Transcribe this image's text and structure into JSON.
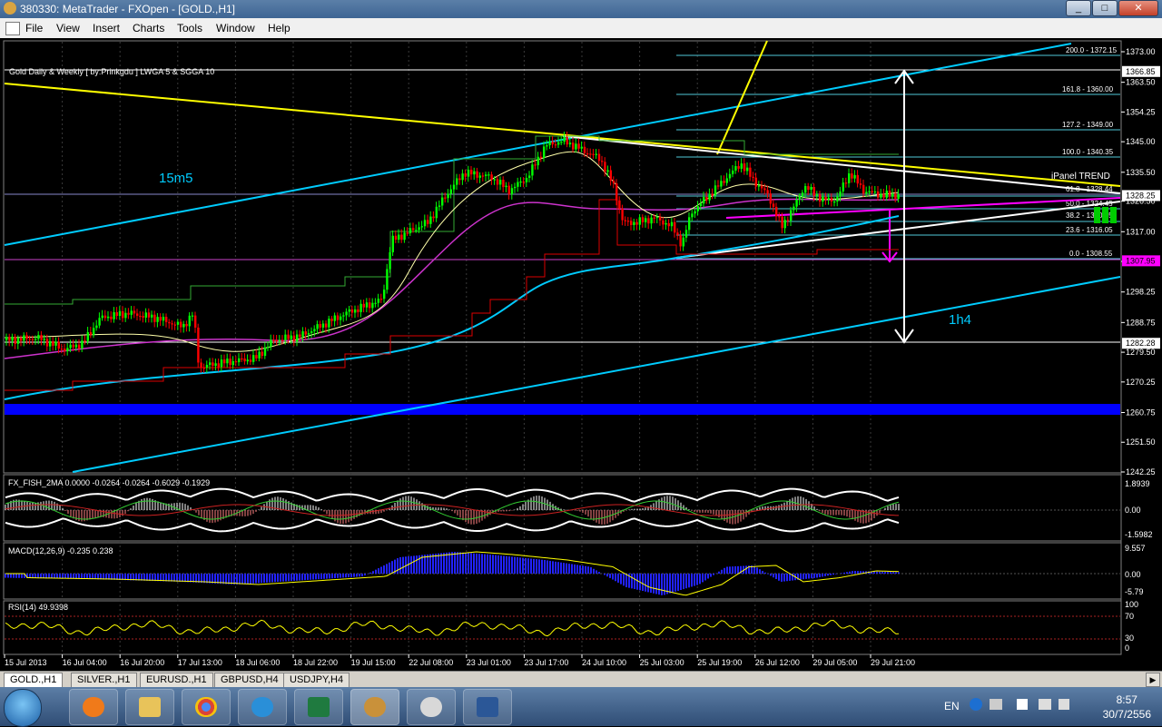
{
  "window": {
    "title": "380330: MetaTrader - FXOpen - [GOLD.,H1]",
    "buttons": [
      "_",
      "□",
      "✕"
    ]
  },
  "menu": [
    "File",
    "View",
    "Insert",
    "Charts",
    "Tools",
    "Window",
    "Help"
  ],
  "chart": {
    "info_line": "Gold Daily & Weekly [ by:Prinkgdu ]  LWGA 5  &  SGGA 10",
    "labels": {
      "m15": "15m5",
      "h1": "1h4",
      "ipanel": "iPanel  TREND"
    },
    "price_scale": [
      "1373.00",
      "1363.50",
      "1354.25",
      "1345.00",
      "1335.50",
      "1326.50",
      "1317.00",
      "1307.75",
      "1298.25",
      "1288.75",
      "1279.50",
      "1270.25",
      "1260.75",
      "1251.50",
      "1242.25"
    ],
    "price_tags": [
      {
        "value": "1366.85",
        "color": "#ffffff",
        "text_color": "#000000"
      },
      {
        "value": "1328.25",
        "color": "#ffffff",
        "text_color": "#000000"
      },
      {
        "value": "1307.95",
        "color": "#ff00ff",
        "text_color": "#000000"
      },
      {
        "value": "1282.28",
        "color": "#ffffff",
        "text_color": "#000000"
      }
    ],
    "fib_levels": [
      "200.0 - 1372.15",
      "161.8 - 1360.00",
      "127.2 - 1349.00",
      "100.0 - 1340.35",
      "61.8 - 1328.44",
      "50.0 - 1324.45",
      "38.2 - 1320.45",
      "23.6 - 1316.05",
      "0.0 - 1308.55"
    ],
    "time_axis": [
      "15 Jul 2013",
      "16 Jul 04:00",
      "16 Jul 20:00",
      "17 Jul 13:00",
      "18 Jul 06:00",
      "18 Jul 22:00",
      "19 Jul 15:00",
      "22 Jul 08:00",
      "23 Jul 01:00",
      "23 Jul 17:00",
      "24 Jul 10:00",
      "25 Jul 03:00",
      "25 Jul 19:00",
      "26 Jul 12:00",
      "29 Jul 05:00",
      "29 Jul 21:00"
    ]
  },
  "fisher": {
    "label": "FX_FISH_2MA 0.0000 -0.0264 -0.0264 -0.6029 -0.1929",
    "scale": [
      "1.8939",
      "0.00",
      "-1.5982"
    ]
  },
  "macd": {
    "label": "MACD(12,26,9) -0.235 0.238",
    "scale": [
      "9.557",
      "0.00",
      "-5.79"
    ]
  },
  "rsi": {
    "label": "RSI(14) 49.9398",
    "scale": [
      "100",
      "70",
      "30",
      "0"
    ]
  },
  "tabs": [
    "GOLD.,H1",
    "SILVER.,H1",
    "EURUSD.,H1",
    "GBPUSD,H4",
    "USDJPY,H4"
  ],
  "taskbar": {
    "language": "EN",
    "time": "8:57",
    "date": "30/7/2556",
    "apps": [
      "media-player",
      "file-explorer",
      "chrome",
      "internet-explorer",
      "excel",
      "metatrader",
      "paint",
      "word"
    ]
  },
  "colors": {
    "bull": "#00ff00",
    "bear": "#ff0000",
    "aqua": "#00ccff",
    "yellow": "#ffff00",
    "magenta": "#ff00ff",
    "blue": "#0000ff"
  }
}
